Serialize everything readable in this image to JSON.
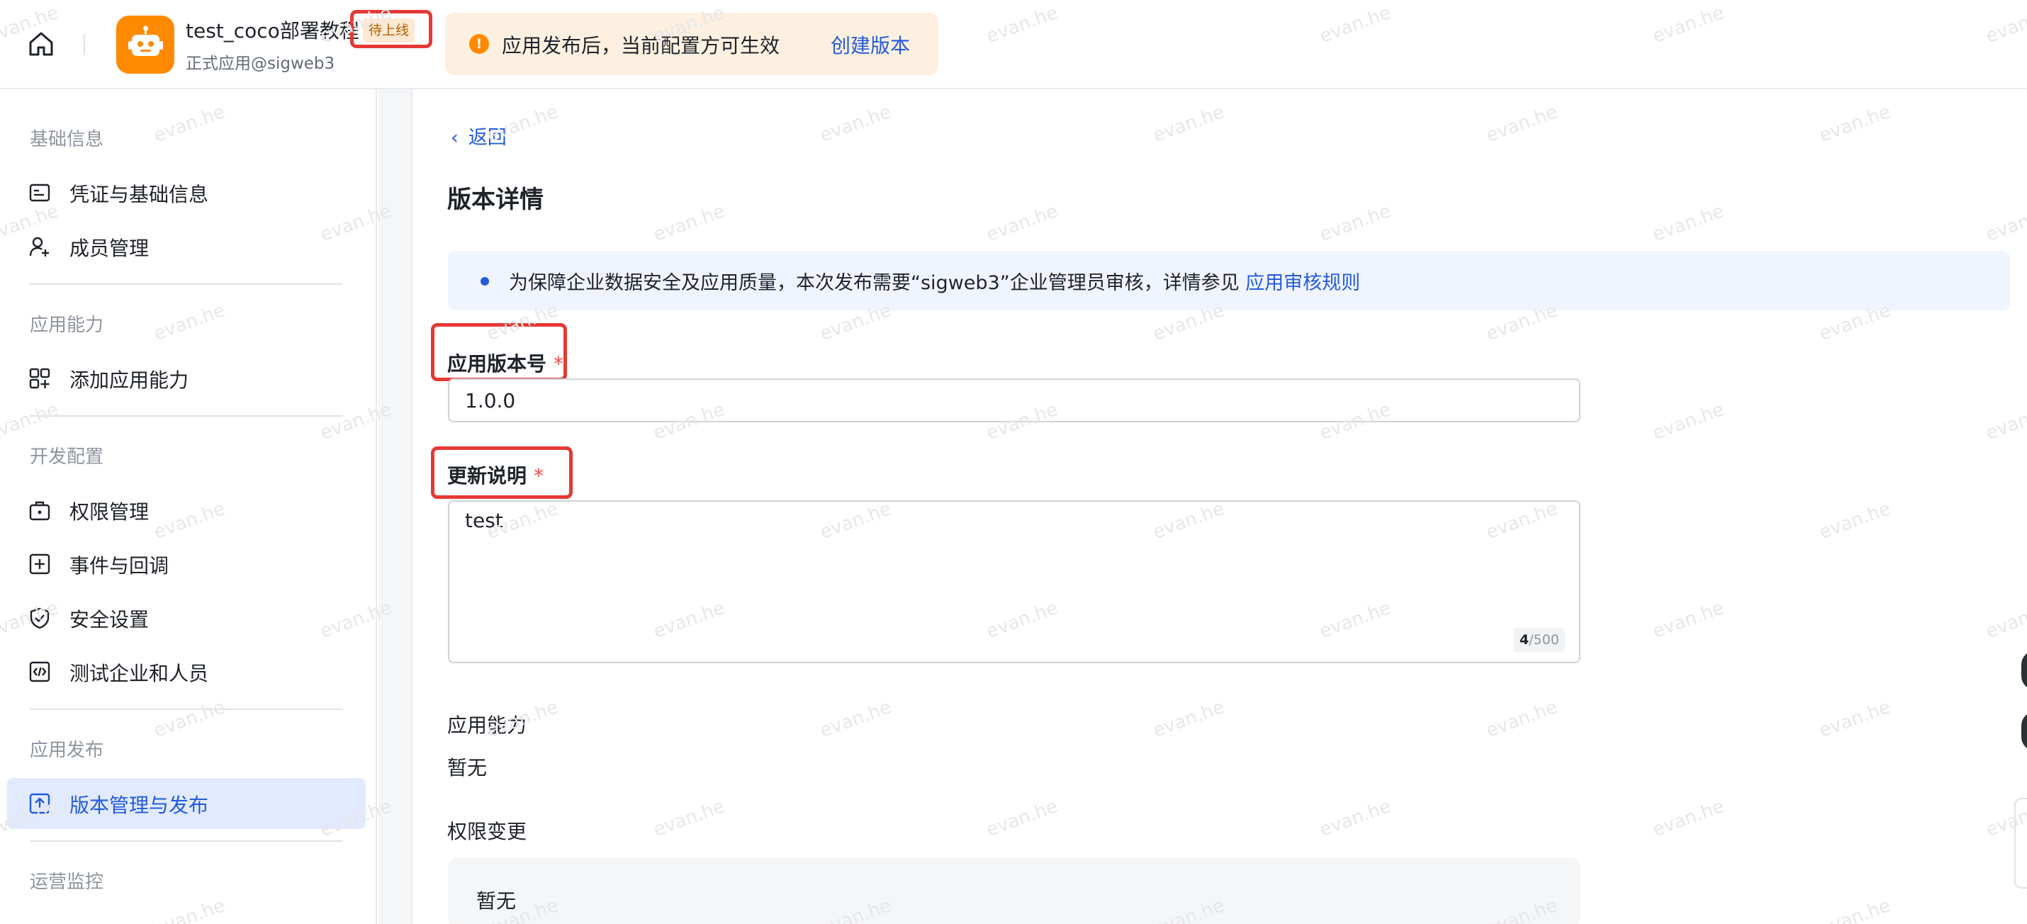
{
  "header": {
    "app_name": "test_coco部署教程",
    "app_subtitle": "正式应用@sigweb3",
    "status_badge": "待上线",
    "notice": {
      "text": "应用发布后，当前配置方可生效",
      "action": "创建版本"
    }
  },
  "sidebar": {
    "sections": [
      {
        "title": "基础信息",
        "items": [
          "凭证与基础信息",
          "成员管理"
        ]
      },
      {
        "title": "应用能力",
        "items": [
          "添加应用能力"
        ]
      },
      {
        "title": "开发配置",
        "items": [
          "权限管理",
          "事件与回调",
          "安全设置",
          "测试企业和人员"
        ]
      },
      {
        "title": "应用发布",
        "items": [
          "版本管理与发布"
        ]
      },
      {
        "title": "运营监控",
        "items": []
      }
    ],
    "active_item": "版本管理与发布"
  },
  "main": {
    "back": "返回",
    "title": "版本详情",
    "banner": {
      "text": "为保障企业数据安全及应用质量，本次发布需要“sigweb3”企业管理员审核，详情参见",
      "link": "应用审核规则"
    },
    "version": {
      "label": "应用版本号",
      "required_mark": "*",
      "value": "1.0.0"
    },
    "notes": {
      "label": "更新说明",
      "required_mark": "*",
      "value": "test",
      "count": "4",
      "max": "/500"
    },
    "capability": {
      "label": "应用能力",
      "value": "暂无"
    },
    "permission": {
      "label": "权限变更",
      "value": "暂无"
    }
  },
  "watermark": "evan.he",
  "colors": {
    "accent": "#245bdb",
    "active_bg": "#e1eaff",
    "notice_bg": "#fdf0e0",
    "warning": "#ff8a00",
    "highlight": "#e53935",
    "required": "#f54a45"
  },
  "icons": {
    "home": "home-icon",
    "app_logo": "robot-icon",
    "notice": "warning-circle-icon",
    "back": "chevron-left-icon"
  }
}
